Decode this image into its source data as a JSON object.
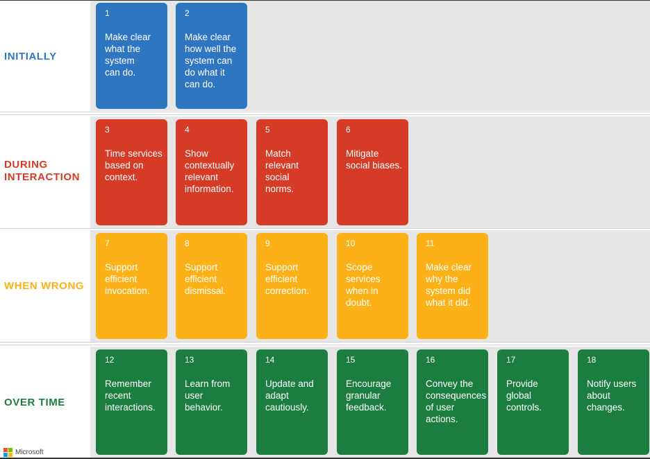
{
  "colors": {
    "initially": "#2F76C0",
    "during": "#D63B26",
    "wrong": "#FBB117",
    "overtime": "#1C7E3E"
  },
  "bands": [
    {
      "label": "INITIALLY",
      "color": "#2F76C0",
      "cards": [
        {
          "num": "1",
          "text": "Make clear\nwhat the\nsystem\ncan do."
        },
        {
          "num": "2",
          "text": "Make clear\nhow well the\nsystem can\ndo what it\ncan do."
        }
      ]
    },
    {
      "label": "DURING\nINTERACTION",
      "color": "#D63B26",
      "cards": [
        {
          "num": "3",
          "text": "Time services\nbased on\ncontext."
        },
        {
          "num": "4",
          "text": "Show\ncontextually\nrelevant\ninformation."
        },
        {
          "num": "5",
          "text": "Match\nrelevant\nsocial\nnorms."
        },
        {
          "num": "6",
          "text": "Mitigate\nsocial biases."
        }
      ]
    },
    {
      "label": "WHEN WRONG",
      "color": "#FBB117",
      "cards": [
        {
          "num": "7",
          "text": "Support\nefficient\ninvocation."
        },
        {
          "num": "8",
          "text": "Support\nefficient\ndismissal."
        },
        {
          "num": "9",
          "text": "Support\nefficient\ncorrection."
        },
        {
          "num": "10",
          "text": "Scope\nservices\nwhen in\ndoubt."
        },
        {
          "num": "11",
          "text": "Make clear\nwhy the\nsystem did\nwhat it did."
        }
      ]
    },
    {
      "label": "OVER TIME",
      "color": "#1C7E3E",
      "cards": [
        {
          "num": "12",
          "text": "Remember\nrecent\ninteractions."
        },
        {
          "num": "13",
          "text": "Learn from\nuser\nbehavior."
        },
        {
          "num": "14",
          "text": "Update and\nadapt\ncautiously."
        },
        {
          "num": "15",
          "text": "Encourage\ngranular\nfeedback."
        },
        {
          "num": "16",
          "text": "Convey the\nconsequences\nof user\nactions."
        },
        {
          "num": "17",
          "text": "Provide\nglobal\ncontrols."
        },
        {
          "num": "18",
          "text": "Notify users\nabout\nchanges."
        }
      ]
    }
  ],
  "logo": {
    "text": "Microsoft",
    "icon": "microsoft-logo-icon",
    "colors": [
      "#F25022",
      "#7FBA00",
      "#00A4EF",
      "#FFB900"
    ]
  }
}
